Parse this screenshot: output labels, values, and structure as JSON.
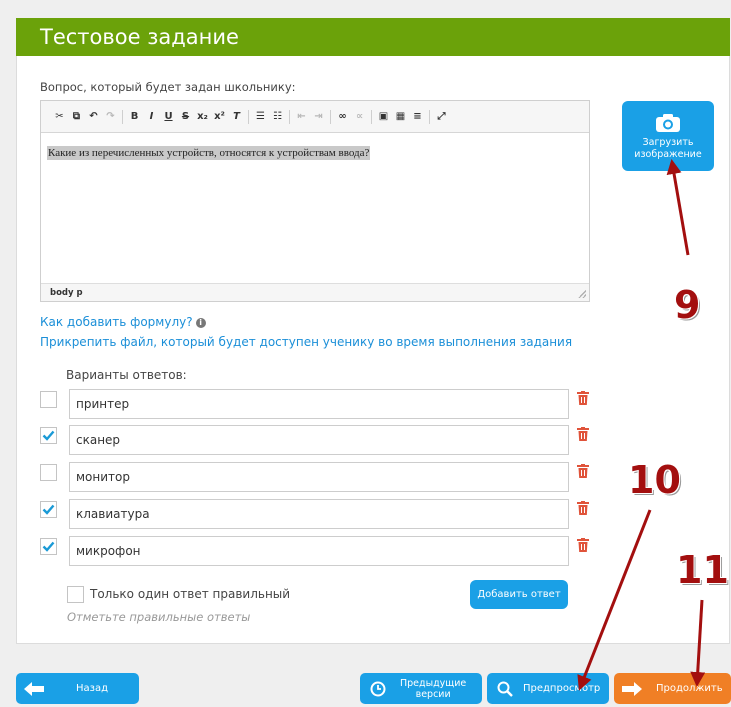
{
  "header": {
    "title": "Тестовое задание"
  },
  "question": {
    "label": "Вопрос, который будет задан школьнику:",
    "text": "Какие из перечисленных устройств, относятся к устройствам ввода?",
    "footer_path": "body  p"
  },
  "upload": {
    "label_line1": "Загрузить",
    "label_line2": "изображение"
  },
  "links": {
    "formula": "Как добавить формулу?",
    "attach": "Прикрепить файл, который будет доступен ученику во время выполнения задания"
  },
  "answers": {
    "label": "Варианты ответов:",
    "items": [
      {
        "text": "принтер",
        "checked": false
      },
      {
        "text": "сканер",
        "checked": true
      },
      {
        "text": "монитор",
        "checked": false
      },
      {
        "text": "клавиатура",
        "checked": true
      },
      {
        "text": "микрофон",
        "checked": true
      }
    ],
    "only_one_label": "Только один ответ правильный",
    "hint": "Отметьте правильные ответы",
    "add_button": "Добавить ответ"
  },
  "footer": {
    "back": "Назад",
    "prev_versions_line1": "Предыдущие",
    "prev_versions_line2": "версии",
    "preview": "Предпросмотр",
    "continue": "Продолжить"
  },
  "annotations": {
    "m9": "9",
    "m10": "10",
    "m11": "11"
  },
  "colors": {
    "header_green": "#6ba20a",
    "primary_blue": "#1aa0e6",
    "accent_orange": "#f07f25",
    "marker_red": "#a30f0f",
    "check_blue": "#1a9ad6",
    "trash_red": "#e0533a"
  }
}
